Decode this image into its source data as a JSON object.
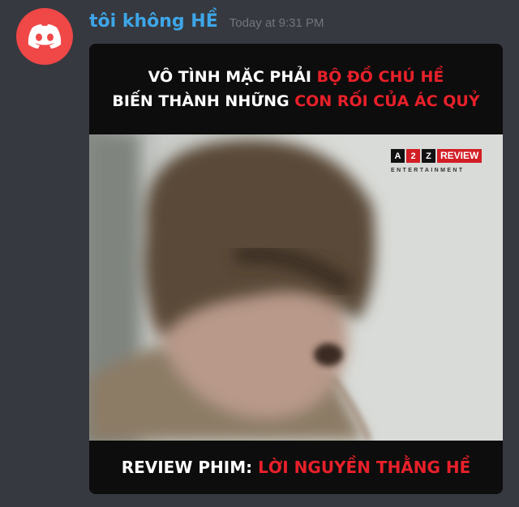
{
  "message": {
    "username": "tôi không HỀ",
    "timestamp": "Today at 9:31 PM",
    "avatar_icon": "discord-logo-icon",
    "avatar_color": "#f04747"
  },
  "image": {
    "title_line1_white": "VÔ TÌNH MẶC PHẢI ",
    "title_line1_red": "BỘ ĐỒ CHÚ HỀ",
    "title_line2_white": "BIẾN THÀNH NHỮNG ",
    "title_line2_red": "CON RỐI CỦA ÁC QUỶ",
    "bottom_white": "REVIEW PHIM: ",
    "bottom_red": "LỜI NGUYỀN THẰNG HỀ",
    "logo": {
      "letters": [
        "A",
        "2",
        "Z"
      ],
      "review": "REVIEW",
      "entertainment": "ENTERTAINMENT"
    },
    "accent_red": "#e8202a"
  }
}
